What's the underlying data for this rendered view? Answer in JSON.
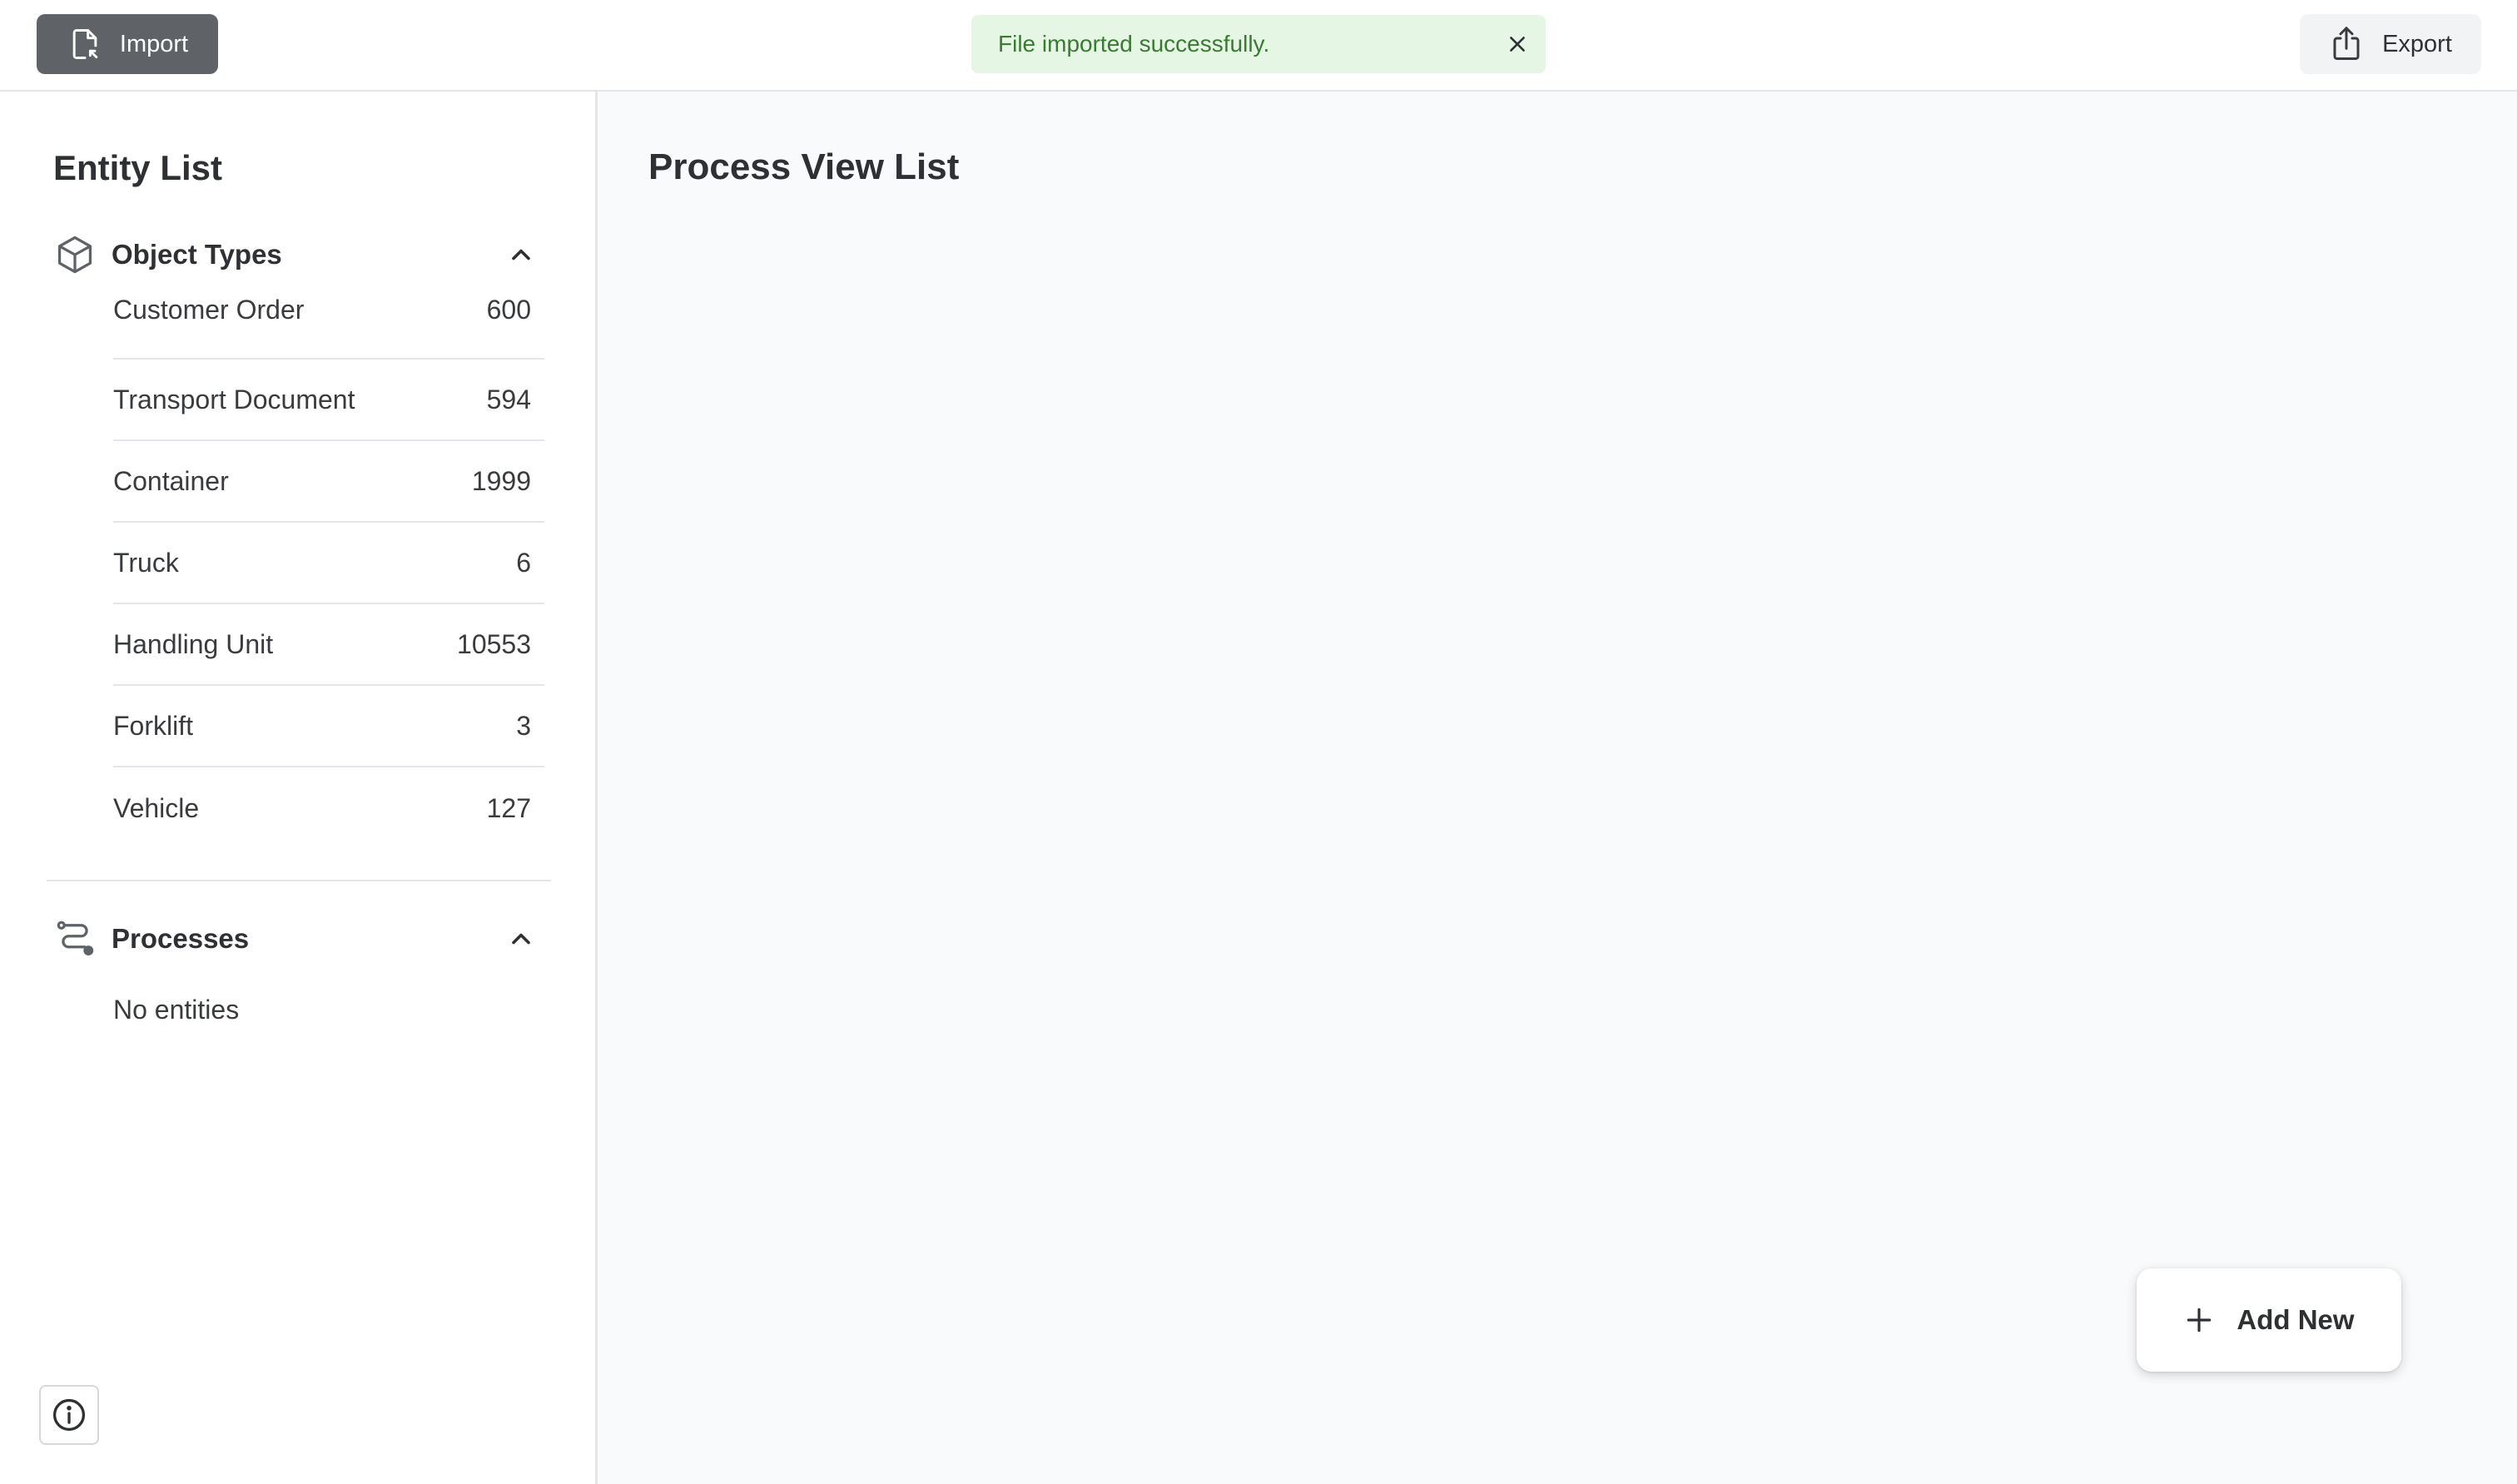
{
  "header": {
    "import_label": "Import",
    "import_icon": "file-import-icon",
    "toast_message": "File imported successfully.",
    "toast_color": "#3b7a33",
    "toast_bg": "#e6f6e4",
    "export_label": "Export",
    "export_icon": "share-export-icon"
  },
  "sidebar": {
    "title": "Entity List",
    "object_types": {
      "label": "Object Types",
      "icon": "cube-icon",
      "expanded": true,
      "items": [
        {
          "name": "Customer Order",
          "count": "600"
        },
        {
          "name": "Transport Document",
          "count": "594"
        },
        {
          "name": "Container",
          "count": "1999"
        },
        {
          "name": "Truck",
          "count": "6"
        },
        {
          "name": "Handling Unit",
          "count": "10553"
        },
        {
          "name": "Forklift",
          "count": "3"
        },
        {
          "name": "Vehicle",
          "count": "127"
        }
      ]
    },
    "processes": {
      "label": "Processes",
      "icon": "route-icon",
      "expanded": true,
      "empty_text": "No entities"
    },
    "info_icon": "info-icon"
  },
  "main": {
    "title": "Process View List",
    "add_new_label": "Add New",
    "add_new_icon": "plus-icon"
  }
}
